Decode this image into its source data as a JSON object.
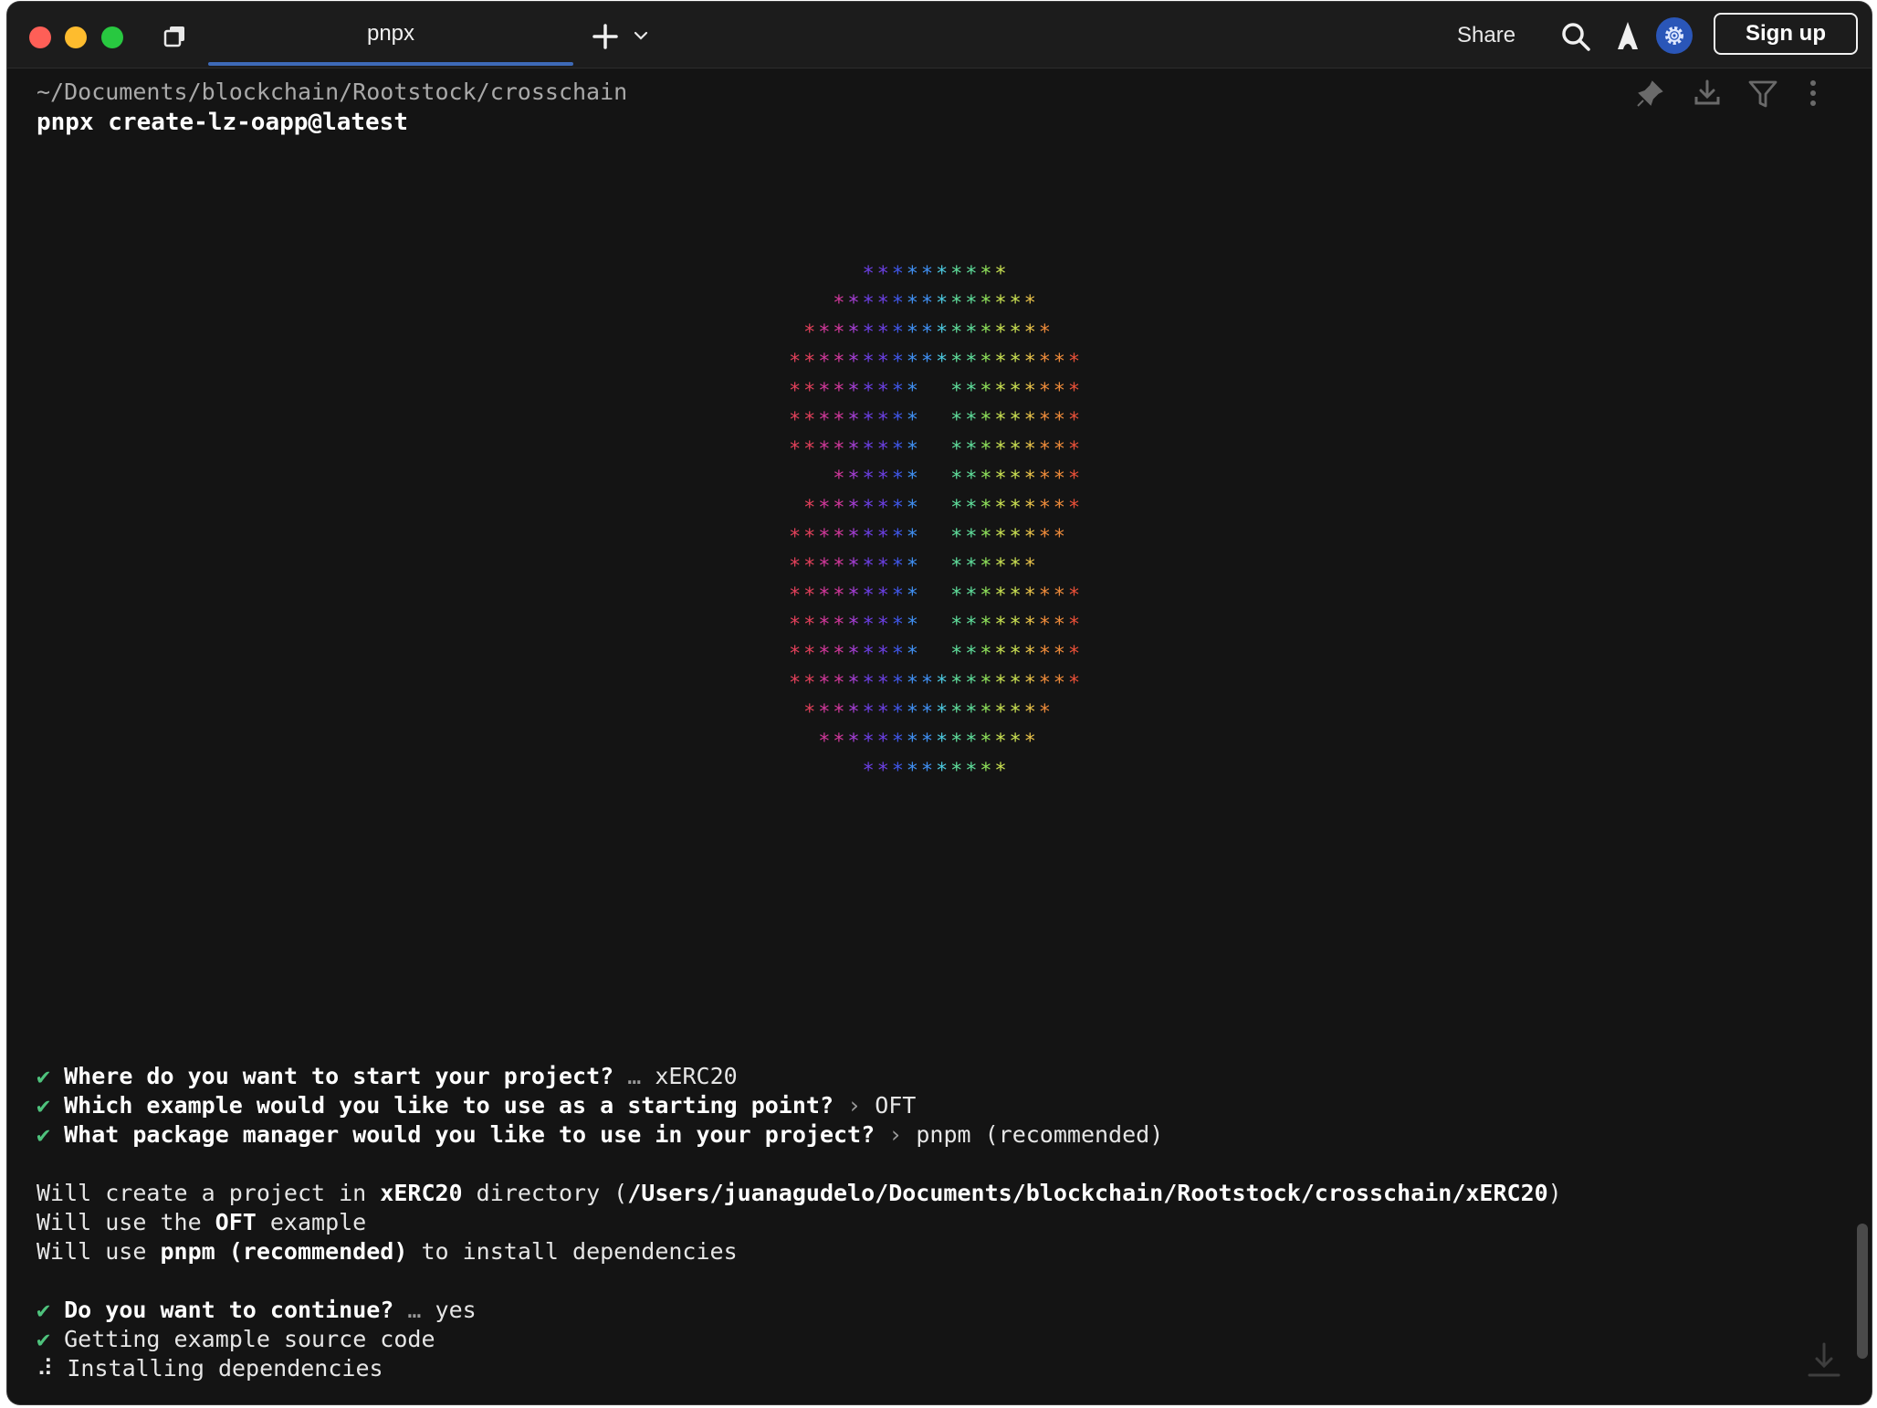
{
  "window": {
    "tab_title": "pnpx",
    "share_label": "Share",
    "signup_label": "Sign up",
    "accent_color": "#3e6ab8"
  },
  "icons": {
    "tabs": "tabs-icon",
    "new_tab": "plus-icon",
    "dropdown": "chevron-down-icon",
    "search": "search-icon",
    "ai": "ai-agent-icon",
    "settings": "gear-icon",
    "pin": "pin-icon",
    "download": "download-icon",
    "filter": "filter-icon",
    "more": "more-vertical-icon",
    "scroll_bottom": "scroll-to-bottom-icon"
  },
  "block": {
    "path": "~/Documents/blockchain/Rootstock/crosschain",
    "command": "pnpx create-lz-oapp@latest"
  },
  "logo_rows": [
    "**********",
    "**************",
    "*****************",
    "********************",
    "*********  *********",
    "*********  *********",
    "*********  *********",
    "******  *********",
    "********  *********",
    "*********  ********",
    "*********  ******",
    "*********  *********",
    "*********  *********",
    "*********  *********",
    "********************",
    "*****************",
    "***************",
    "**********"
  ],
  "output": {
    "q1": {
      "mark": "✔",
      "question": "Where do you want to start your project?",
      "sep": "…",
      "answer": "xERC20"
    },
    "q2": {
      "mark": "✔",
      "question": "Which example would you like to use as a starting point?",
      "sep": "›",
      "answer": "OFT"
    },
    "q3": {
      "mark": "✔",
      "question": "What package manager would you like to use in your project?",
      "sep": "›",
      "answer": "pnpm (recommended)"
    },
    "info1": {
      "pre": "Will create a project in ",
      "dir": "xERC20",
      "mid": " directory (",
      "full_path": "/Users/juanagudelo/Documents/blockchain/Rootstock/crosschain/xERC20",
      "post": ")"
    },
    "info2": {
      "pre": "Will use the ",
      "example": "OFT",
      "post": " example"
    },
    "info3": {
      "pre": "Will use ",
      "pm": "pnpm (recommended)",
      "post": " to install dependencies"
    },
    "q4": {
      "mark": "✔",
      "question": "Do you want to continue?",
      "sep": "…",
      "answer": "yes"
    },
    "step1": {
      "mark": "✔",
      "text": "Getting example source code"
    },
    "step2": {
      "mark": "⠼",
      "text": "Installing dependencies"
    }
  }
}
